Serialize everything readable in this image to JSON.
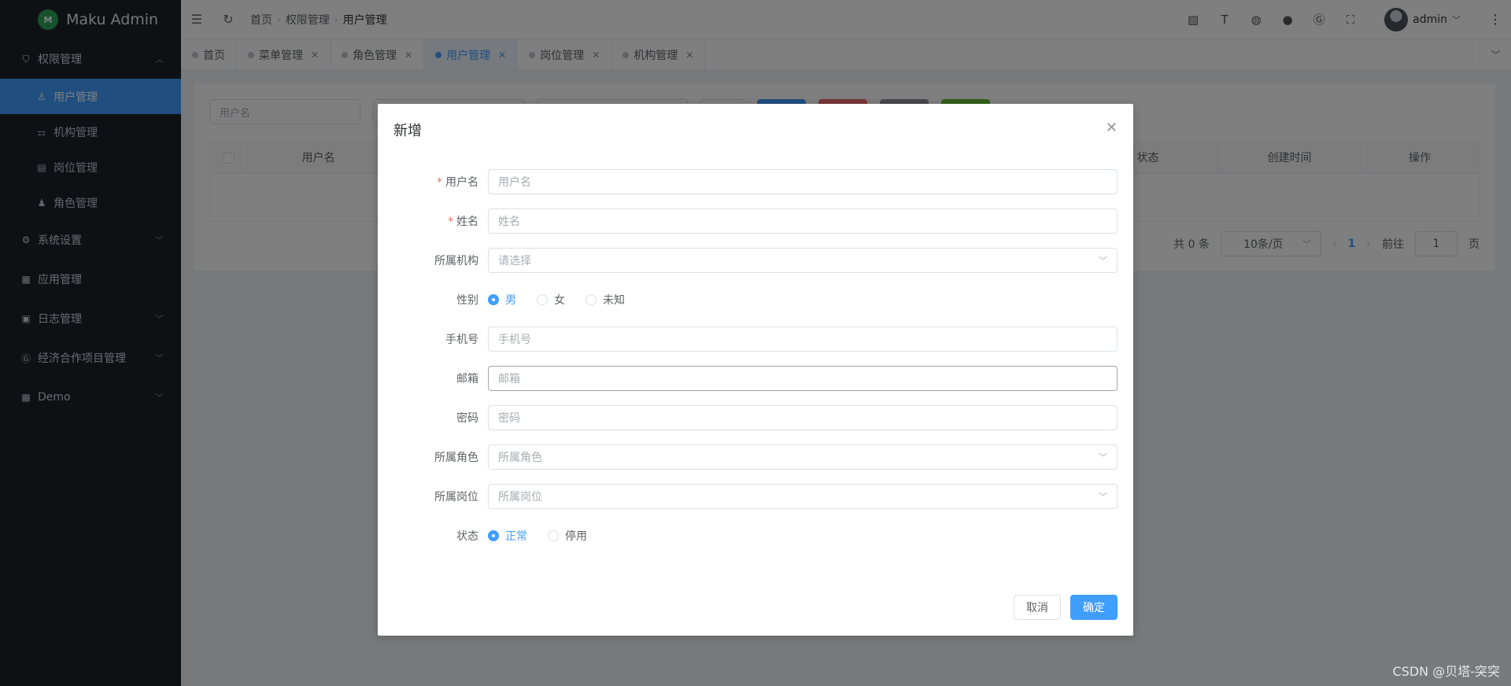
{
  "app": {
    "title": "Maku Admin",
    "logo_glyph": "M"
  },
  "sidebar": {
    "groups": [
      {
        "label": "权限管理",
        "icon": "shield-icon",
        "expanded": true,
        "items": [
          {
            "label": "用户管理",
            "icon": "user-icon",
            "active": true
          },
          {
            "label": "机构管理",
            "icon": "org-icon",
            "active": false
          },
          {
            "label": "岗位管理",
            "icon": "post-icon",
            "active": false
          },
          {
            "label": "角色管理",
            "icon": "role-icon",
            "active": false
          }
        ]
      },
      {
        "label": "系统设置",
        "icon": "gear-icon"
      },
      {
        "label": "应用管理",
        "icon": "grid-icon"
      },
      {
        "label": "日志管理",
        "icon": "log-icon"
      },
      {
        "label": "经济合作项目管理",
        "icon": "project-icon"
      },
      {
        "label": "Demo",
        "icon": "demo-icon"
      }
    ]
  },
  "header": {
    "breadcrumb": [
      "首页",
      "权限管理",
      "用户管理"
    ],
    "user": "admin",
    "tools": [
      "image-icon",
      "font-size-icon",
      "language-icon",
      "github-icon",
      "gitee-icon",
      "fullscreen-icon"
    ]
  },
  "tabs": [
    {
      "label": "首页",
      "closable": false,
      "active": false
    },
    {
      "label": "菜单管理",
      "closable": true,
      "active": false
    },
    {
      "label": "角色管理",
      "closable": true,
      "active": false
    },
    {
      "label": "用户管理",
      "closable": true,
      "active": true
    },
    {
      "label": "岗位管理",
      "closable": true,
      "active": false
    },
    {
      "label": "机构管理",
      "closable": true,
      "active": false
    }
  ],
  "page": {
    "filter_username_placeholder": "用户名",
    "table_headers": [
      "用户名",
      "状态",
      "创建时间",
      "操作"
    ],
    "pagination": {
      "total": "共 0 条",
      "page_size": "10条/页",
      "current": "1",
      "goto_label": "前往",
      "goto_value": "1",
      "page_suffix": "页"
    }
  },
  "dialog": {
    "title": "新增",
    "fields": {
      "username": {
        "label": "用户名",
        "placeholder": "用户名",
        "required": true
      },
      "realname": {
        "label": "姓名",
        "placeholder": "姓名",
        "required": true
      },
      "org": {
        "label": "所属机构",
        "placeholder": "请选择"
      },
      "gender": {
        "label": "性别",
        "options": [
          "男",
          "女",
          "未知"
        ],
        "selected": "男"
      },
      "mobile": {
        "label": "手机号",
        "placeholder": "手机号"
      },
      "email": {
        "label": "邮箱",
        "placeholder": "邮箱"
      },
      "password": {
        "label": "密码",
        "placeholder": "密码"
      },
      "roles": {
        "label": "所属角色",
        "placeholder": "所属角色"
      },
      "posts": {
        "label": "所属岗位",
        "placeholder": "所属岗位"
      },
      "status": {
        "label": "状态",
        "options": [
          "正常",
          "停用"
        ],
        "selected": "正常"
      }
    },
    "cancel_label": "取消",
    "ok_label": "确定"
  },
  "colors": {
    "primary": "#409eff",
    "sidebar_bg": "#1d2329",
    "danger": "#f56c6c",
    "success": "#67c23a",
    "info": "#909399"
  },
  "watermark": "CSDN @贝塔-突突"
}
